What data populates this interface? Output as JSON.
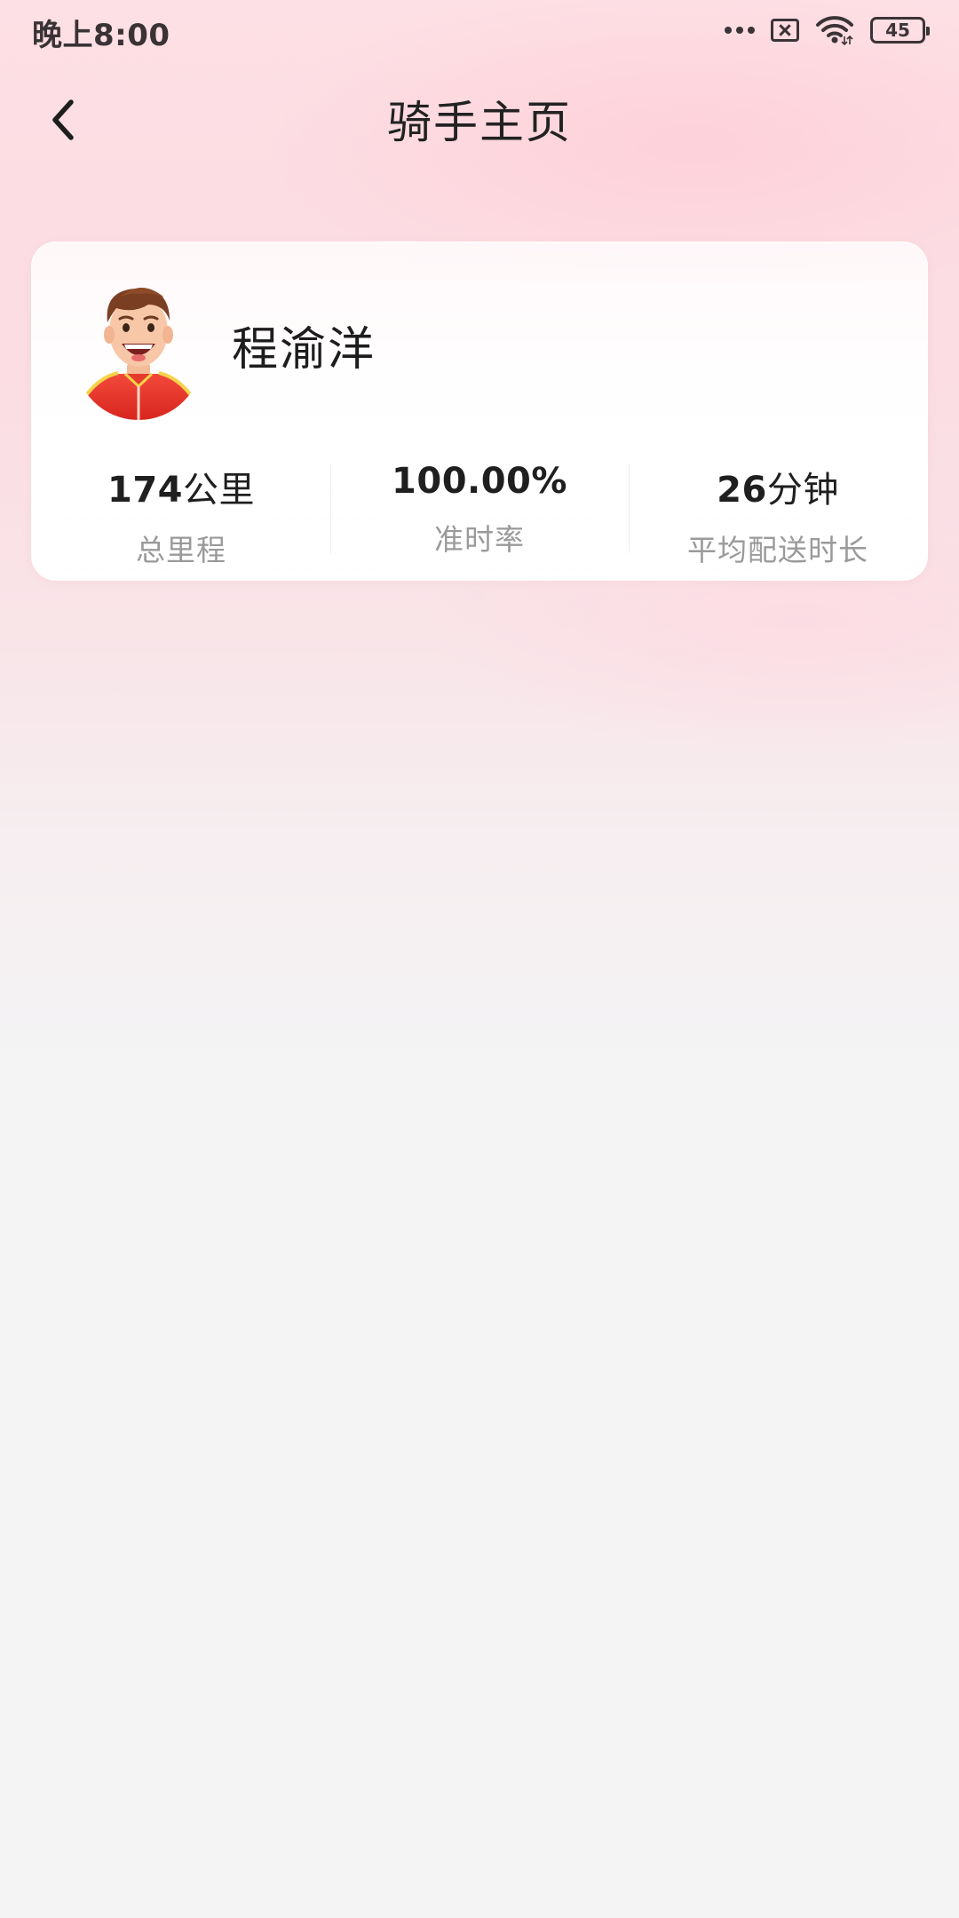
{
  "status_bar": {
    "time": "晚上8:00",
    "battery": "45",
    "icons": [
      "more-dots-icon",
      "no-sim-icon",
      "wifi-icon",
      "battery-icon"
    ]
  },
  "nav": {
    "title": "骑手主页",
    "back_icon": "chevron-left-icon"
  },
  "profile": {
    "name": "程渝洋",
    "avatar": "rider-avatar",
    "stats": [
      {
        "number": "174",
        "unit": "公里",
        "label": "总里程"
      },
      {
        "number": "100.00%",
        "unit": "",
        "label": "准时率"
      },
      {
        "number": "26",
        "unit": "分钟",
        "label": "平均配送时长"
      }
    ]
  },
  "colors": {
    "accent_red": "#e8312e",
    "bg_pink": "#fde0e5",
    "bg_gray": "#f4f4f5"
  }
}
